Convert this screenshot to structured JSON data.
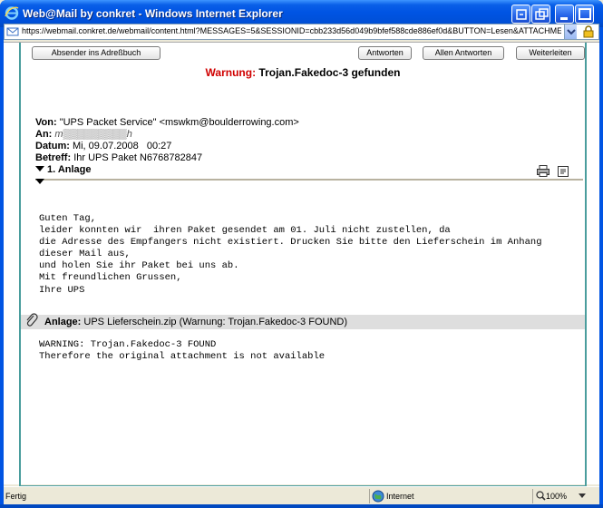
{
  "window": {
    "title": "Web@Mail by conkret - Windows Internet Explorer"
  },
  "address": {
    "url": "https://webmail.conkret.de/webmail/content.html?MESSAGES=5&SESSIONID=cbb233d56d049b9bfef588cde886ef0d&BUTTON=Lesen&ATTACHMENT="
  },
  "toolbar": {
    "add_sender_label": "Absender ins Adreßbuch",
    "reply_label": "Antworten",
    "reply_all_label": "Allen Antworten",
    "forward_label": "Weiterleiten"
  },
  "warning": {
    "label": "Warnung:",
    "text": "Trojan.Fakedoc-3 gefunden"
  },
  "header": {
    "from_label": "Von:",
    "from_value": "\"UPS Packet Service\" <mswkm@boulderrowing.com>",
    "to_label": "An:",
    "to_value": "m▒▒▒▒▒▒▒▒▒h",
    "date_label": "Datum:",
    "date_value": "Mi, 09.07.2008   00:27",
    "subject_label": "Betreff:",
    "subject_value": "Ihr UPS Paket N6768782847",
    "attachments_label": "1. Anlage"
  },
  "body": {
    "text": "Guten Tag,\nleider konnten wir  ihren Paket gesendet am 01. Juli nicht zustellen, da\ndie Adresse des Empfangers nicht existiert. Drucken Sie bitte den Lieferschein im Anhang\ndieser Mail aus,\nund holen Sie ihr Paket bei uns ab.\nMit freundlichen Grussen,\nIhre UPS"
  },
  "attachment": {
    "label": "Anlage:",
    "value": "UPS Lieferschein.zip (Warnung: Trojan.Fakedoc-3 FOUND)",
    "message": "WARNING: Trojan.Fakedoc-3 FOUND\nTherefore the original attachment is not available"
  },
  "status": {
    "left": "Fertig",
    "zone": "Internet",
    "zoom": "100%"
  },
  "colors": {
    "titlebar": "#0054e3",
    "warning_red": "#d00000",
    "panel_border": "#4a9d9d",
    "attachment_bar": "#dedede"
  }
}
